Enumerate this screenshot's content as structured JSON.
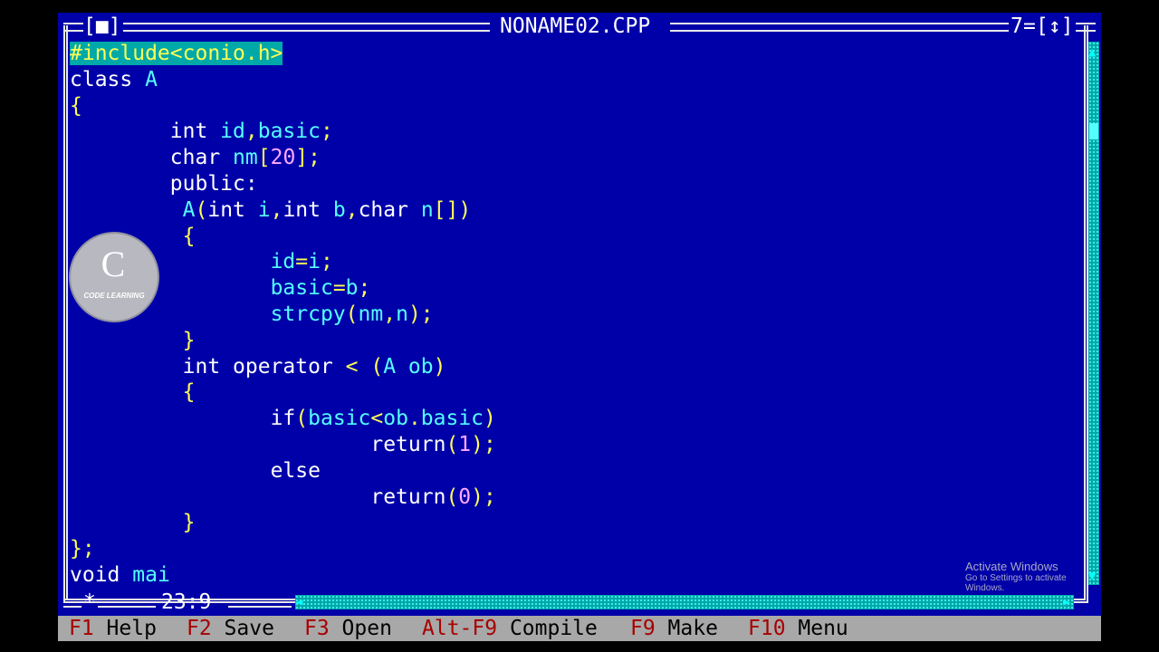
{
  "window": {
    "title": "NONAME02.CPP",
    "close_box": "[■]",
    "window_number": "7",
    "zoom_box": "[↕]"
  },
  "editor": {
    "lines": [
      {
        "indent": "",
        "tokens": [
          {
            "t": "#include<conio.h>",
            "c": "sel"
          }
        ]
      },
      {
        "indent": "",
        "tokens": [
          {
            "t": "class ",
            "c": "kw"
          },
          {
            "t": "A",
            "c": "id"
          }
        ]
      },
      {
        "indent": "",
        "tokens": [
          {
            "t": "{",
            "c": "pn"
          }
        ]
      },
      {
        "indent": "        ",
        "tokens": [
          {
            "t": "int ",
            "c": "kw"
          },
          {
            "t": "id",
            "c": "id"
          },
          {
            "t": ",",
            "c": "pn"
          },
          {
            "t": "basic",
            "c": "id"
          },
          {
            "t": ";",
            "c": "pn"
          }
        ]
      },
      {
        "indent": "        ",
        "tokens": [
          {
            "t": "char ",
            "c": "kw"
          },
          {
            "t": "nm",
            "c": "id"
          },
          {
            "t": "[",
            "c": "pn"
          },
          {
            "t": "20",
            "c": "num"
          },
          {
            "t": "];",
            "c": "pn"
          }
        ]
      },
      {
        "indent": "        ",
        "tokens": [
          {
            "t": "public:",
            "c": "kw"
          }
        ]
      },
      {
        "indent": "         ",
        "tokens": [
          {
            "t": "A",
            "c": "id"
          },
          {
            "t": "(",
            "c": "pn"
          },
          {
            "t": "int ",
            "c": "kw"
          },
          {
            "t": "i",
            "c": "id"
          },
          {
            "t": ",",
            "c": "pn"
          },
          {
            "t": "int ",
            "c": "kw"
          },
          {
            "t": "b",
            "c": "id"
          },
          {
            "t": ",",
            "c": "pn"
          },
          {
            "t": "char ",
            "c": "kw"
          },
          {
            "t": "n",
            "c": "id"
          },
          {
            "t": "[])",
            "c": "pn"
          }
        ]
      },
      {
        "indent": "         ",
        "tokens": [
          {
            "t": "{",
            "c": "pn"
          }
        ]
      },
      {
        "indent": "                ",
        "tokens": [
          {
            "t": "id",
            "c": "id"
          },
          {
            "t": "=",
            "c": "pn"
          },
          {
            "t": "i",
            "c": "id"
          },
          {
            "t": ";",
            "c": "pn"
          }
        ]
      },
      {
        "indent": "                ",
        "tokens": [
          {
            "t": "basic",
            "c": "id"
          },
          {
            "t": "=",
            "c": "pn"
          },
          {
            "t": "b",
            "c": "id"
          },
          {
            "t": ";",
            "c": "pn"
          }
        ]
      },
      {
        "indent": "                ",
        "tokens": [
          {
            "t": "strcpy",
            "c": "id"
          },
          {
            "t": "(",
            "c": "pn"
          },
          {
            "t": "nm",
            "c": "id"
          },
          {
            "t": ",",
            "c": "pn"
          },
          {
            "t": "n",
            "c": "id"
          },
          {
            "t": ");",
            "c": "pn"
          }
        ]
      },
      {
        "indent": "         ",
        "tokens": [
          {
            "t": "}",
            "c": "pn"
          }
        ]
      },
      {
        "indent": "         ",
        "tokens": [
          {
            "t": "int ",
            "c": "kw"
          },
          {
            "t": "operator ",
            "c": "kw"
          },
          {
            "t": "< ",
            "c": "pn"
          },
          {
            "t": "(",
            "c": "pn"
          },
          {
            "t": "A ",
            "c": "id"
          },
          {
            "t": "ob",
            "c": "id"
          },
          {
            "t": ")",
            "c": "pn"
          }
        ]
      },
      {
        "indent": "         ",
        "tokens": [
          {
            "t": "{",
            "c": "pn"
          }
        ]
      },
      {
        "indent": "                ",
        "tokens": [
          {
            "t": "if",
            "c": "kw"
          },
          {
            "t": "(",
            "c": "pn"
          },
          {
            "t": "basic",
            "c": "id"
          },
          {
            "t": "<",
            "c": "pn"
          },
          {
            "t": "ob",
            "c": "id"
          },
          {
            "t": ".",
            "c": "pn"
          },
          {
            "t": "basic",
            "c": "id"
          },
          {
            "t": ")",
            "c": "pn"
          }
        ]
      },
      {
        "indent": "                        ",
        "tokens": [
          {
            "t": "return",
            "c": "kw"
          },
          {
            "t": "(",
            "c": "pn"
          },
          {
            "t": "1",
            "c": "num"
          },
          {
            "t": ");",
            "c": "pn"
          }
        ]
      },
      {
        "indent": "                ",
        "tokens": [
          {
            "t": "else",
            "c": "kw"
          }
        ]
      },
      {
        "indent": "                        ",
        "tokens": [
          {
            "t": "return",
            "c": "kw"
          },
          {
            "t": "(",
            "c": "pn"
          },
          {
            "t": "0",
            "c": "num"
          },
          {
            "t": ");",
            "c": "pn"
          }
        ]
      },
      {
        "indent": "         ",
        "tokens": [
          {
            "t": "}",
            "c": "pn"
          }
        ]
      },
      {
        "indent": "",
        "tokens": [
          {
            "t": "};",
            "c": "pn"
          }
        ]
      },
      {
        "indent": "",
        "tokens": [
          {
            "t": "void ",
            "c": "kw"
          },
          {
            "t": "mai",
            "c": "id"
          }
        ]
      }
    ]
  },
  "status": {
    "cursor_position": "23:9",
    "modified_marker": "*"
  },
  "menu": [
    {
      "key": "F1",
      "label": "Help"
    },
    {
      "key": "F2",
      "label": "Save"
    },
    {
      "key": "F3",
      "label": "Open"
    },
    {
      "key": "Alt-F9",
      "label": "Compile"
    },
    {
      "key": "F9",
      "label": "Make"
    },
    {
      "key": "F10",
      "label": "Menu"
    }
  ],
  "watermark": {
    "line1": "Activate Windows",
    "line2": "Go to Settings to activate Windows."
  },
  "logo": {
    "text": "CODE LEARNING"
  },
  "colors": {
    "editor_bg": "#0000a8",
    "menu_bg": "#a8a8a8",
    "hotkey": "#a80000",
    "selection": "#00a8a8"
  }
}
